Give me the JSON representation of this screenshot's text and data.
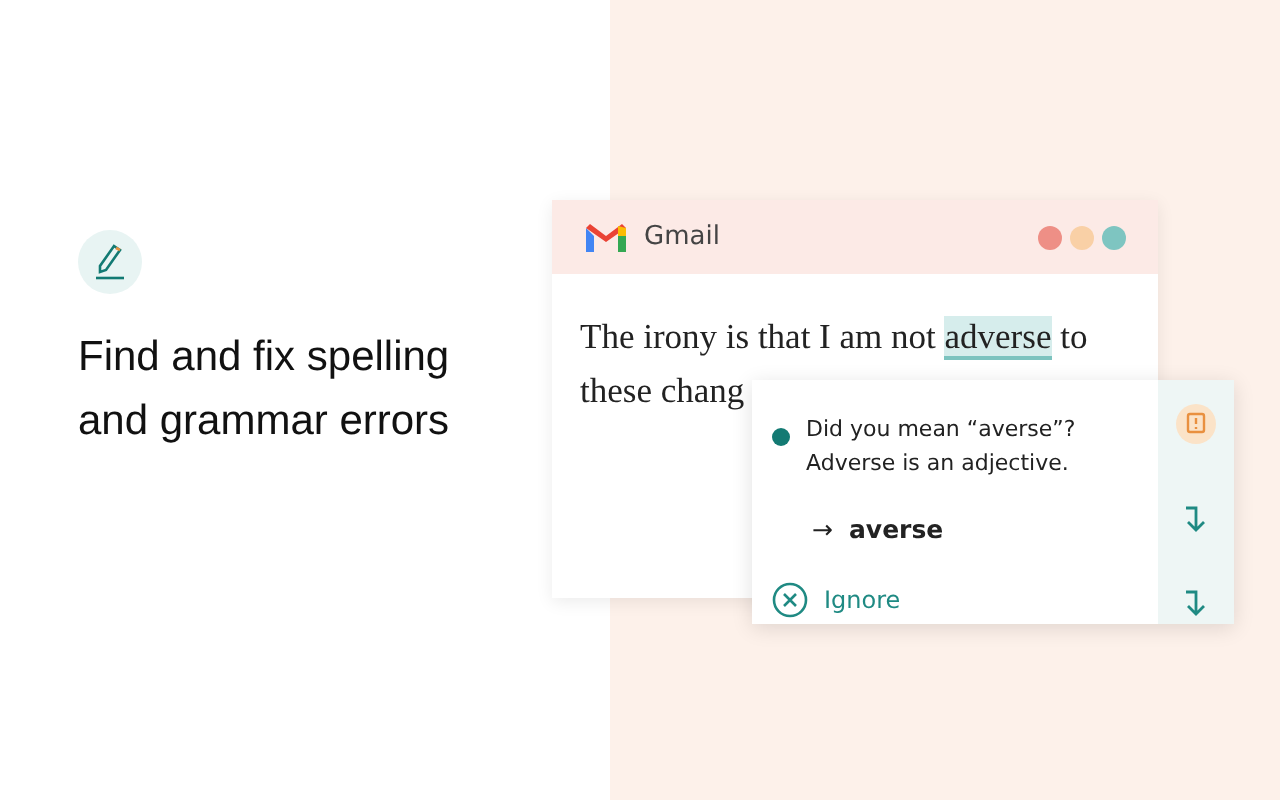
{
  "headline": "Find and fix spelling and grammar errors",
  "email_window": {
    "title": "Gmail",
    "dots": [
      {
        "color": "#ee8f86"
      },
      {
        "color": "#f9d0a6"
      },
      {
        "color": "#7ec5c1"
      }
    ],
    "text_before": "The irony is that I am not ",
    "flagged_word": "adverse",
    "text_after": " to",
    "second_line": "these chang"
  },
  "suggestion": {
    "message": "Did you mean “averse”?",
    "explanation": "Adverse is an adjective.",
    "replacement_arrow": "→",
    "replacement": "averse",
    "ignore": "Ignore"
  }
}
